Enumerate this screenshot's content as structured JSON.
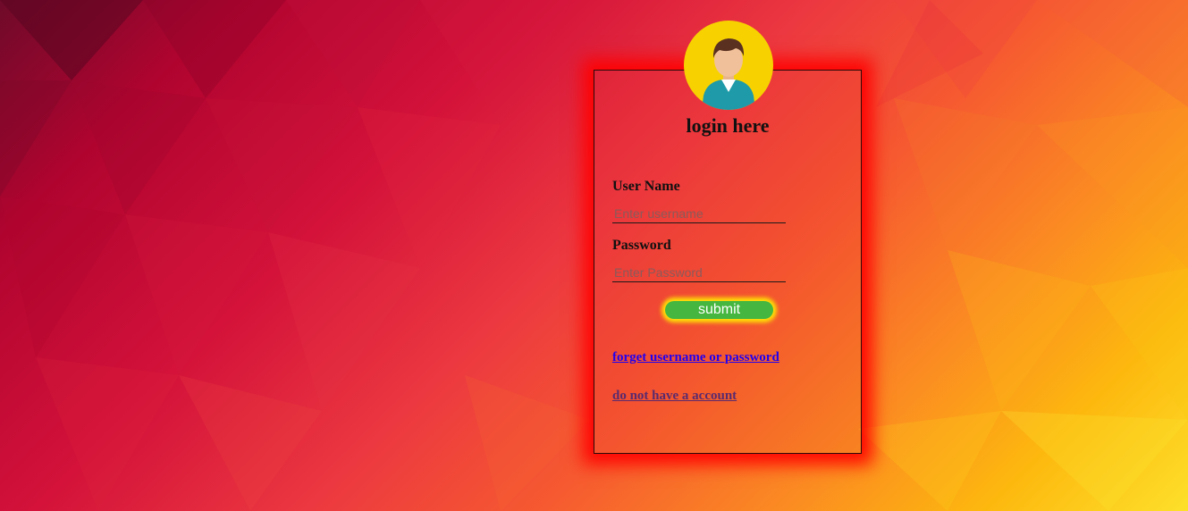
{
  "login": {
    "title": "login here",
    "username": {
      "label": "User Name",
      "placeholder": "Enter username",
      "value": ""
    },
    "password": {
      "label": "Password",
      "placeholder": "Enter Password",
      "value": ""
    },
    "submit_label": "submit",
    "forgot_link": "forget username or password",
    "register_link": "do not have a account"
  },
  "icons": {
    "avatar": "user-avatar-icon"
  },
  "colors": {
    "box_glow": "#ff0000",
    "avatar_bg": "#f7d200",
    "submit_bg": "#45b63f",
    "submit_glow": "#fff000",
    "forgot_link": "#2200ee",
    "register_link": "#5a2a6e"
  }
}
